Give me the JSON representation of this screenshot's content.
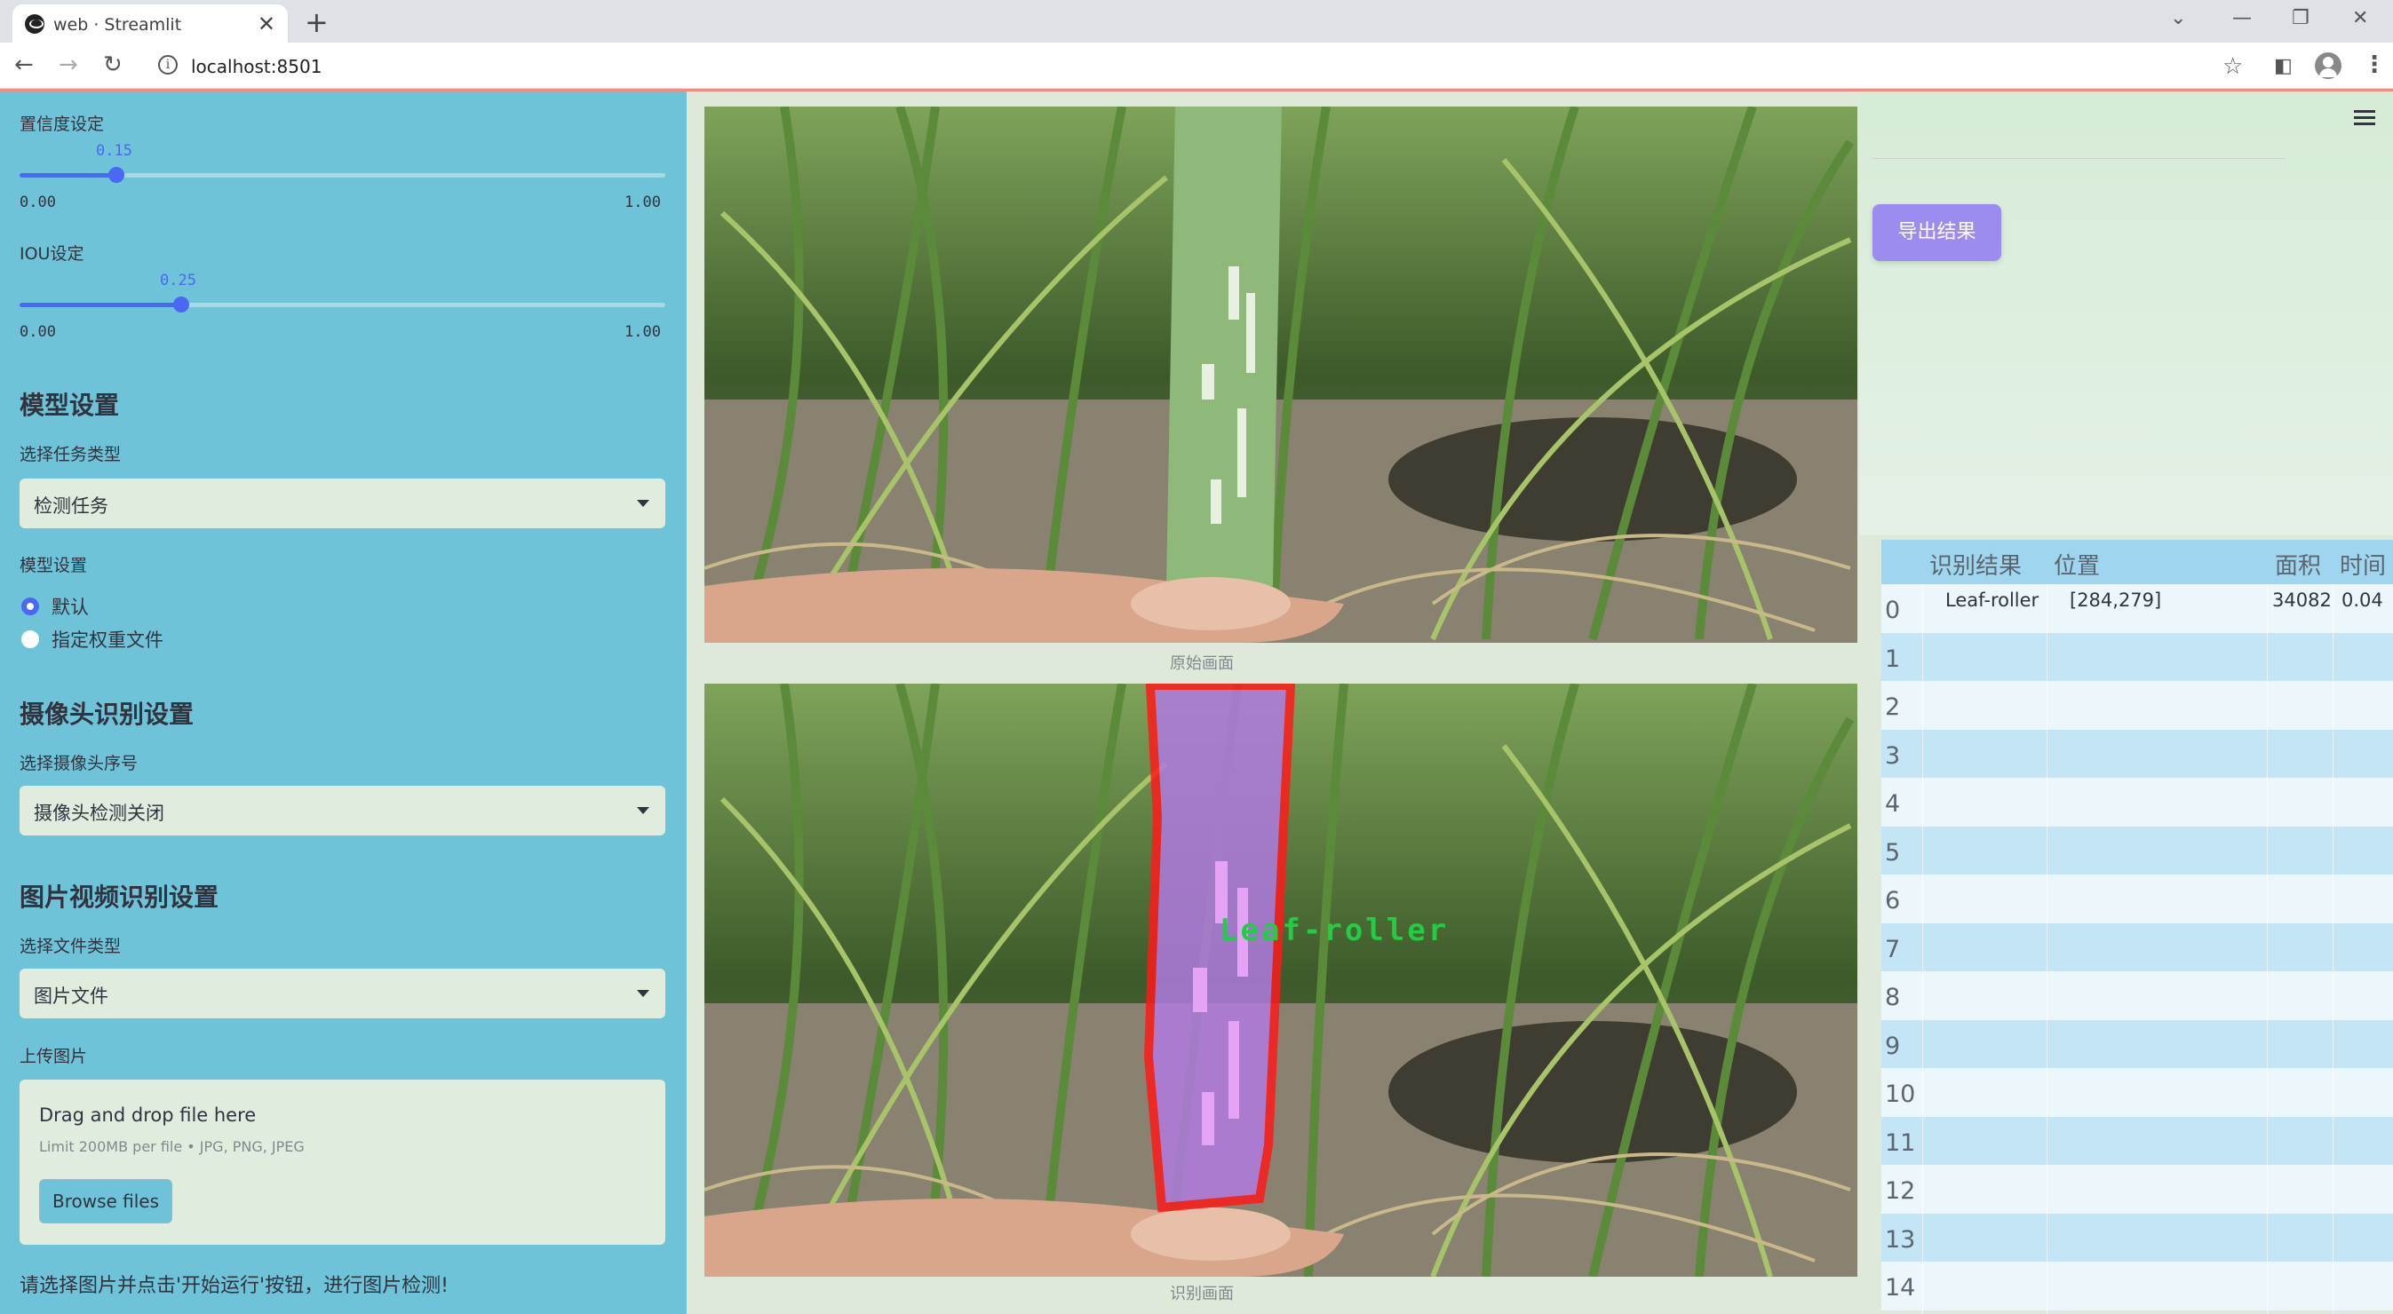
{
  "browser": {
    "tab_title": "web · Streamlit",
    "url": "localhost:8501"
  },
  "sidebar": {
    "confidence": {
      "label": "置信度设定",
      "value": "0.15",
      "min": "0.00",
      "max": "1.00",
      "fraction": 0.15
    },
    "iou": {
      "label": "IOU设定",
      "value": "0.25",
      "min": "0.00",
      "max": "1.00",
      "fraction": 0.25
    },
    "model_heading": "模型设置",
    "task_type_label": "选择任务类型",
    "task_type_value": "检测任务",
    "model_settings_label": "模型设置",
    "radio_options": [
      "默认",
      "指定权重文件"
    ],
    "radio_selected": 0,
    "camera_heading": "摄像头识别设置",
    "camera_label": "选择摄像头序号",
    "camera_value": "摄像头检测关闭",
    "media_heading": "图片视频识别设置",
    "file_type_label": "选择文件类型",
    "file_type_value": "图片文件",
    "upload_label": "上传图片",
    "uploader": {
      "title": "Drag and drop file here",
      "limit": "Limit 200MB per file • JPG, PNG, JPEG",
      "browse": "Browse files"
    },
    "hint": "请选择图片并点击'开始运行'按钮，进行图片检测!"
  },
  "main": {
    "original_caption": "原始画面",
    "detected_caption": "识别画面",
    "detection_label": "Leaf-roller",
    "export_button": "导出结果"
  },
  "table": {
    "headers": [
      "识别结果",
      "位置",
      "面积",
      "时间"
    ],
    "rows": [
      {
        "idx": "0",
        "result": "Leaf-roller",
        "position": "[284,279]",
        "area": "34082",
        "time": "0.04"
      },
      {
        "idx": "1"
      },
      {
        "idx": "2"
      },
      {
        "idx": "3"
      },
      {
        "idx": "4"
      },
      {
        "idx": "5"
      },
      {
        "idx": "6"
      },
      {
        "idx": "7"
      },
      {
        "idx": "8"
      },
      {
        "idx": "9"
      },
      {
        "idx": "10"
      },
      {
        "idx": "11"
      },
      {
        "idx": "12"
      },
      {
        "idx": "13"
      },
      {
        "idx": "14"
      }
    ]
  },
  "colors": {
    "sidebar_bg": "#6fc3d9",
    "accent": "#4a67f5",
    "export_btn": "#9d8cf0",
    "detection_box": "#ff1a1a",
    "detection_fill": "#b07ae0",
    "detection_text": "#22cc44"
  }
}
